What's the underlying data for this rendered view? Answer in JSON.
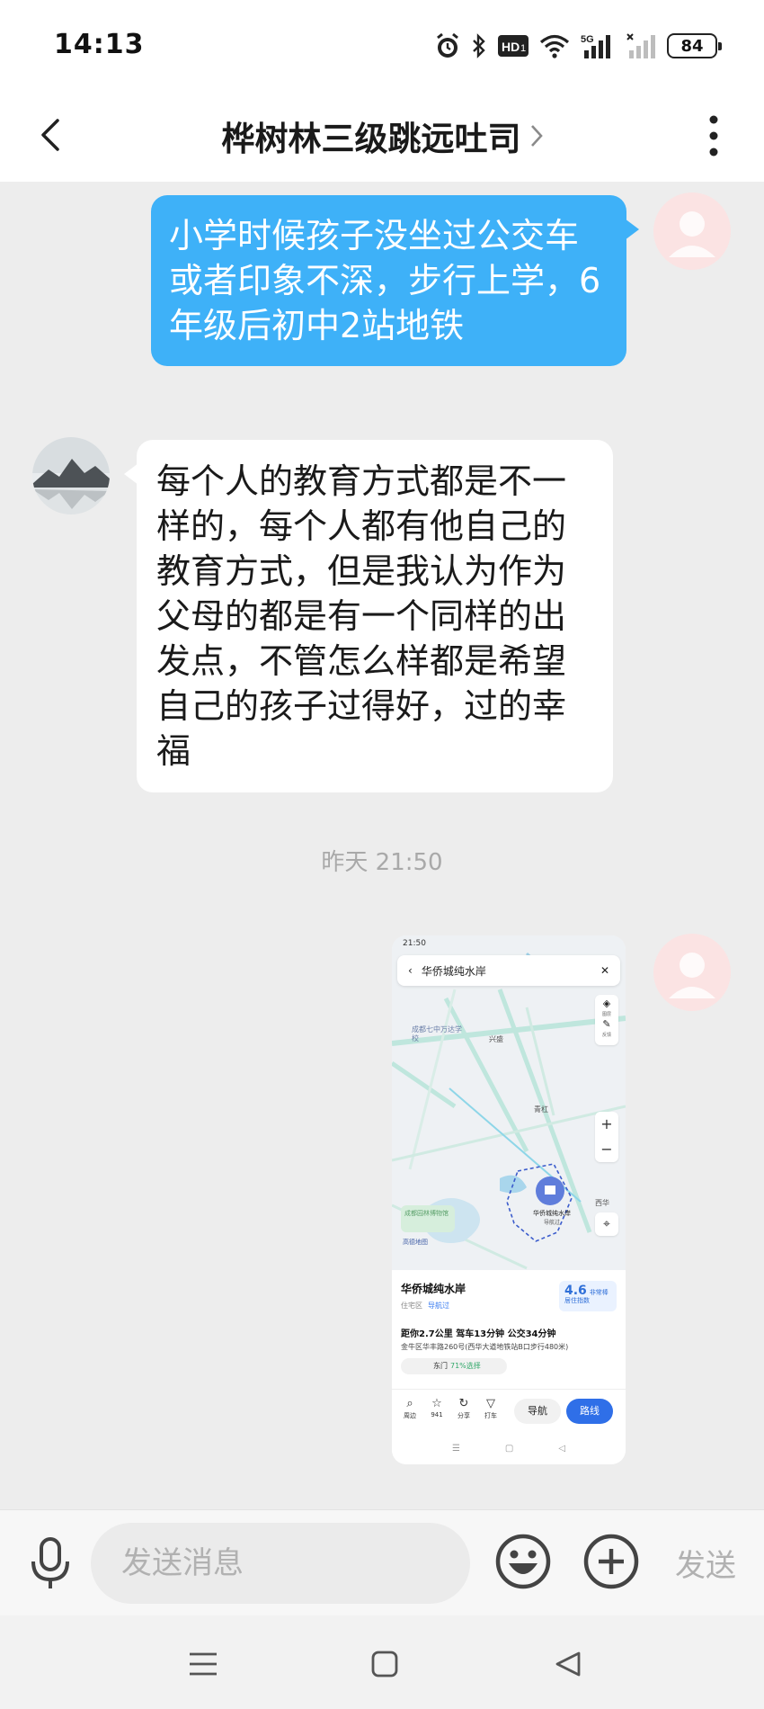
{
  "status_bar": {
    "time": "14:13",
    "battery": "84",
    "network": "5G",
    "hd_label": "HD1"
  },
  "header": {
    "title": "桦树林三级跳远吐司",
    "back_icon": "back-chevron-icon",
    "more_icon": "more-vertical-icon"
  },
  "messages": [
    {
      "direction": "out",
      "text": "小学时候孩子没坐过公交车或者印象不深，步行上学，6年级后初中2站地铁"
    },
    {
      "direction": "in",
      "text": "每个人的教育方式都是不一样的，每个人都有他自己的教育方式，但是我认为作为父母的都是有一个同样的出发点，不管怎么样都是希望自己的孩子过得好，过的幸福"
    }
  ],
  "timestamp": "昨天 21:50",
  "map_thumbnail": {
    "status_time": "21:50",
    "search_text": "华侨城纯水岸",
    "labels": {
      "school": "成都七中万达学校",
      "xingsheng": "兴盛",
      "qinghong": "青杠",
      "xihua": "西华",
      "garden": "成都园林博物馆",
      "gaode": "高德地图",
      "pin_label": "华侨城纯水岸",
      "pin_sub": "导航过",
      "layers": "图层",
      "feedback": "反馈"
    },
    "card": {
      "name": "华侨城纯水岸",
      "type": "住宅区",
      "nav_tag": "导航过",
      "score": "4.6",
      "score_label": "非常棒",
      "score_sub": "居住指数",
      "distance": "距你2.7公里  驾车13分钟  公交34分钟",
      "address": "金牛区华丰路260号(西华大道地铁站B口步行480米)",
      "gate": "东门",
      "gate_pct": "71%选择"
    },
    "toolbar": [
      {
        "icon": "search-icon",
        "label": "周边"
      },
      {
        "icon": "star-icon",
        "label": "941"
      },
      {
        "icon": "share-icon",
        "label": "分享"
      },
      {
        "icon": "taxi-icon",
        "label": "打车"
      }
    ],
    "nav_button": "导航",
    "route_button": "路线"
  },
  "input_bar": {
    "placeholder": "发送消息",
    "send_label": "发送"
  },
  "colors": {
    "outgoing_bubble": "#3eb1f8",
    "incoming_bubble": "#ffffff",
    "background": "#ededed"
  }
}
